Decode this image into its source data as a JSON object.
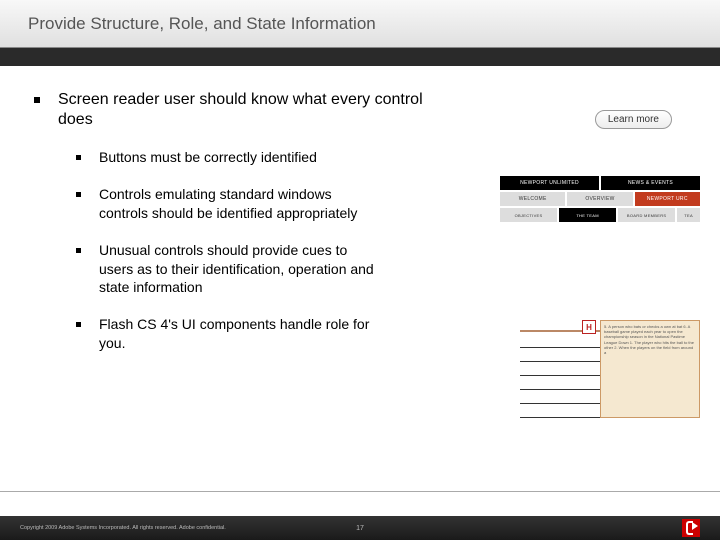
{
  "title": "Provide Structure, Role, and State Information",
  "main_heading": "Screen reader user should know what every control does",
  "bullets": [
    "Buttons must be correctly identified",
    "Controls emulating standard windows controls should be identified appropriately",
    "Unusual controls should provide cues to users as to their identification, operation and state information",
    "Flash CS 4's UI components handle role for you."
  ],
  "learn_more": "Learn more",
  "tabs": {
    "row1": [
      "NEWPORT UNLIMITED",
      "NEWS & EVENTS"
    ],
    "row2": [
      "WELCOME",
      "OVERVIEW",
      "NEWPORT URC"
    ],
    "row3": [
      "OBJECTIVES",
      "THE TEAM",
      "BOARD MEMBERS",
      "TEA"
    ]
  },
  "crossword": {
    "letter": "H",
    "clues": "5. A person who bats or checks a own at bat\n6. A baseball game played each year to open the championship season in the National Pastime League\nDown\n1. The player who hits the ball to the other\n2. When the players on the field from around a"
  },
  "footer": "Copyright 2009 Adobe Systems Incorporated. All rights reserved. Adobe confidential.",
  "page": "17"
}
